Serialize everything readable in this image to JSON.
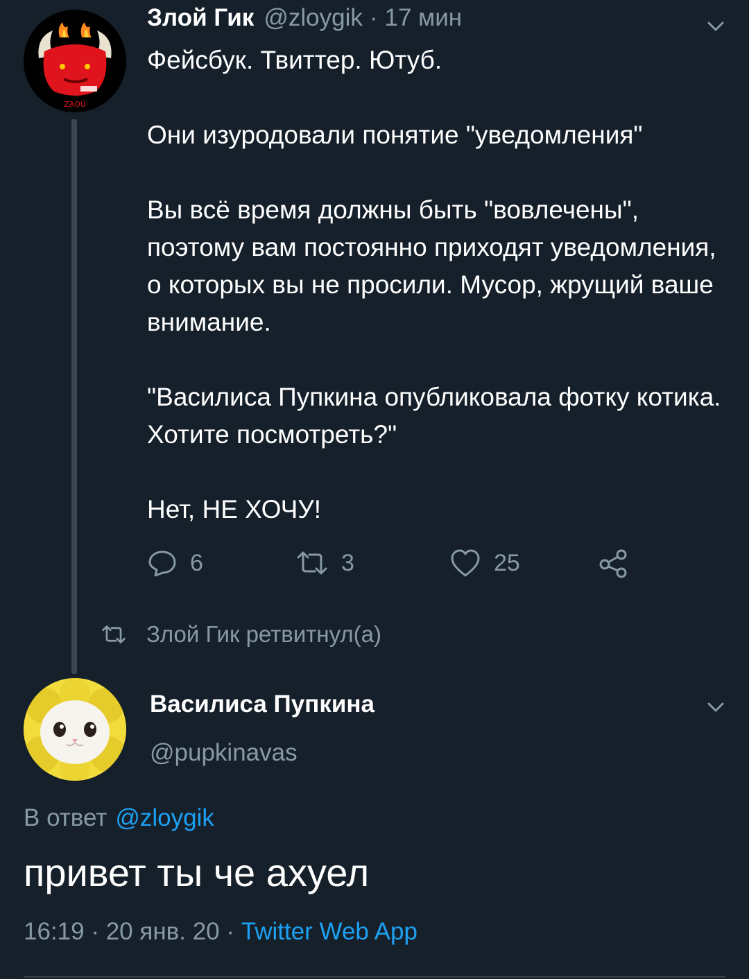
{
  "tweet1": {
    "name": "Злой Гик",
    "handle": "@zloygik",
    "separator": "·",
    "time": "17 мин",
    "avatar_text": "ZAOŬ",
    "paragraphs": [
      "Фейсбук. Твиттер. Ютуб.",
      "Они изуродовали понятие \"уведомления\"",
      "Вы всё время должны быть \"вовлечены\", поэтому вам постоянно приходят уведомления, о которых вы не просили. Мусор, жрущий ваше внимание.",
      "\"Василиса Пупкина опубликовала фотку котика. Хотите посмотреть?\"",
      "Нет, НЕ ХОЧУ!"
    ],
    "actions": {
      "reply_count": "6",
      "retweet_count": "3",
      "like_count": "25"
    }
  },
  "retweet_banner": {
    "text": "Злой Гик ретвитнул(а)"
  },
  "tweet2": {
    "name": "Василиса Пупкина",
    "handle": "@pupkinavas",
    "reply_prefix": "В ответ",
    "reply_mention": "@zloygik",
    "text": "привет ты че ахуел",
    "time": "16:19",
    "sep1": "·",
    "date": "20 янв. 20",
    "sep2": "·",
    "source": "Twitter Web App"
  },
  "colors": {
    "background": "#15202b",
    "primary_text": "#ffffff",
    "secondary_text": "#8899a6",
    "accent": "#1da1f2",
    "thread_line": "#3a4651"
  },
  "icons": [
    "chevron-down-icon",
    "reply-icon",
    "retweet-icon",
    "like-icon",
    "share-icon"
  ]
}
